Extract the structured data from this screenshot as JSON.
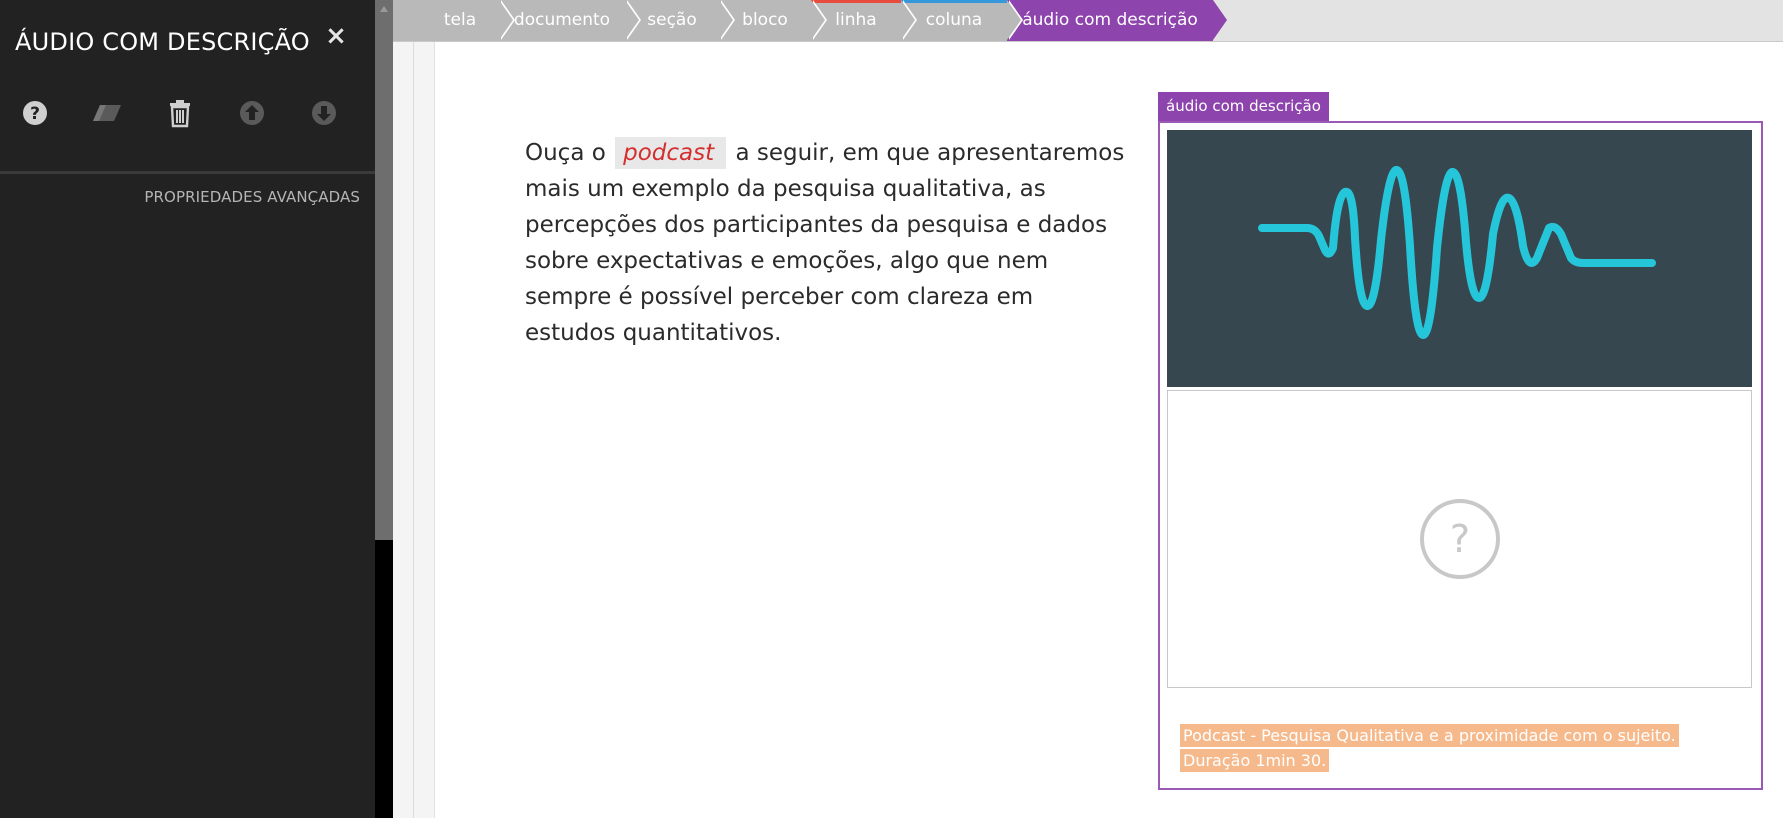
{
  "panel": {
    "title": "ÁUDIO COM DESCRIÇÃO",
    "close_icon": "×",
    "advanced_label": "PROPRIEDADES AVANÇADAS",
    "tools": [
      {
        "name": "help-icon"
      },
      {
        "name": "eraser-icon"
      },
      {
        "name": "trash-icon"
      },
      {
        "name": "move-up-icon"
      },
      {
        "name": "move-down-icon"
      }
    ]
  },
  "breadcrumb": {
    "items": [
      {
        "label": "tela"
      },
      {
        "label": "documento"
      },
      {
        "label": "seção"
      },
      {
        "label": "bloco"
      },
      {
        "label": "linha",
        "accent": "#e74c3c"
      },
      {
        "label": "coluna",
        "accent": "#3498db"
      },
      {
        "label": "áudio com descrição",
        "active": true
      }
    ],
    "active_color": "#8e44ad"
  },
  "content": {
    "text_before": "Ouça o",
    "highlight": "podcast",
    "text_after": "a seguir, em que apresentaremos mais um exemplo da pesquisa qualitativa, as percepções dos participantes da pesquisa e dados sobre expectativas e emoções, algo que nem sempre é possível perceber com clareza em estudos quantitativos."
  },
  "audio": {
    "tag_label": "áudio com descrição",
    "placeholder_icon": "?",
    "caption_line1": "Podcast - Pesquisa Qualitativa e a proximidade com o sujeito.",
    "caption_line2": "Duração 1min 30.",
    "wave_color": "#26c6da",
    "wave_bg": "#37474f",
    "caption_bg": "#f5b98c"
  }
}
